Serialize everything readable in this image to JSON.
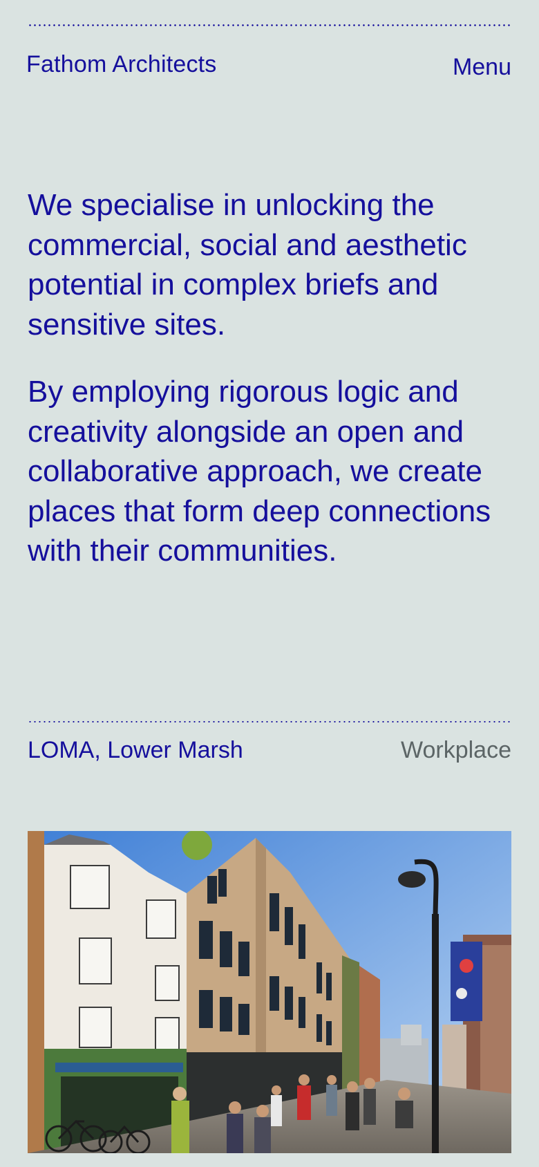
{
  "header": {
    "brand": "Fathom Architects",
    "menu_label": "Menu"
  },
  "intro": {
    "paragraphs": [
      "We specialise in unlocking the commercial, social and aesthetic potential in complex briefs and sensitive sites.",
      "By employing rigorous logic and creativity alongside an open and collaborative approach, we create places that form deep connections with their communities."
    ]
  },
  "featured_project": {
    "name": "LOMA, Lower Marsh",
    "category": "Workplace",
    "image_description_icon": "street-photo"
  },
  "colors": {
    "background": "#dae3e1",
    "accent": "#150f9c",
    "muted": "#5c6566"
  }
}
